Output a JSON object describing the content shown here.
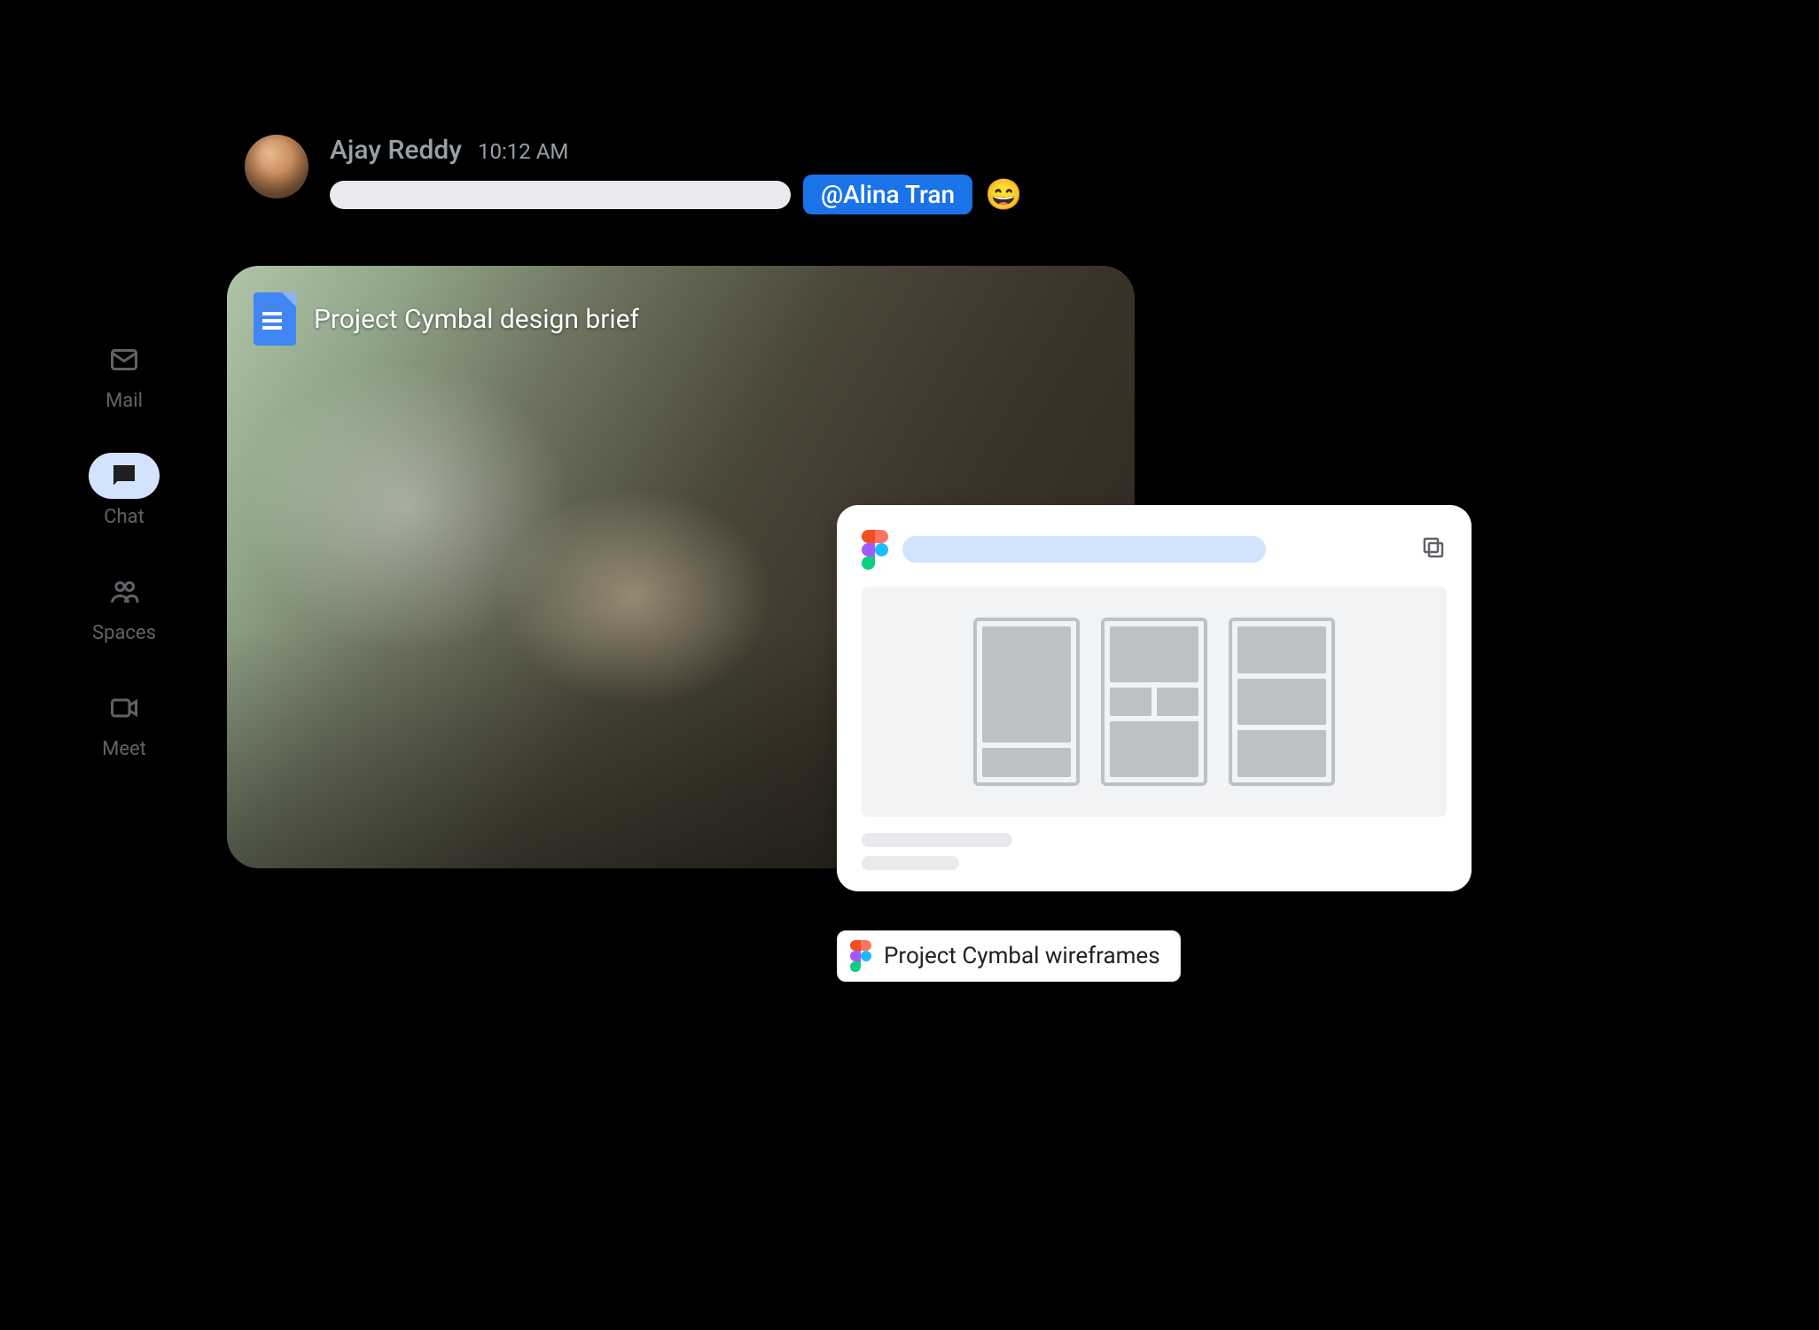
{
  "nav": {
    "items": [
      {
        "id": "mail",
        "label": "Mail",
        "active": false
      },
      {
        "id": "chat",
        "label": "Chat",
        "active": true
      },
      {
        "id": "spaces",
        "label": "Spaces",
        "active": false
      },
      {
        "id": "meet",
        "label": "Meet",
        "active": false
      }
    ]
  },
  "message": {
    "sender": "Ajay Reddy",
    "timestamp": "10:12 AM",
    "mention": "@Alina Tran",
    "emoji": "😄"
  },
  "attachments": {
    "doc_title": "Project Cymbal design brief",
    "figma_chip_label": "Project Cymbal wireframes"
  }
}
